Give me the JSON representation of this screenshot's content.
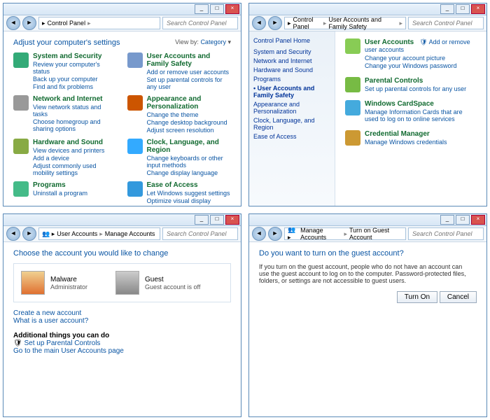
{
  "search_placeholder": "Search Control Panel",
  "p1": {
    "crumb": [
      "Control Panel"
    ],
    "heading": "Adjust your computer's settings",
    "viewby_label": "View by:",
    "viewby_value": "Category",
    "cats": [
      {
        "t": "System and Security",
        "s": [
          "Review your computer's status",
          "Back up your computer",
          "Find and fix problems"
        ]
      },
      {
        "t": "User Accounts and Family Safety",
        "s": [
          "Add or remove user accounts",
          "Set up parental controls for any user"
        ]
      },
      {
        "t": "Network and Internet",
        "s": [
          "View network status and tasks",
          "Choose homegroup and sharing options"
        ]
      },
      {
        "t": "Appearance and Personalization",
        "s": [
          "Change the theme",
          "Change desktop background",
          "Adjust screen resolution"
        ]
      },
      {
        "t": "Hardware and Sound",
        "s": [
          "View devices and printers",
          "Add a device",
          "Adjust commonly used mobility settings"
        ]
      },
      {
        "t": "Clock, Language, and Region",
        "s": [
          "Change keyboards or other input methods",
          "Change display language"
        ]
      },
      {
        "t": "Programs",
        "s": [
          "Uninstall a program"
        ]
      },
      {
        "t": "Ease of Access",
        "s": [
          "Let Windows suggest settings",
          "Optimize visual display"
        ]
      }
    ]
  },
  "p2": {
    "crumb": [
      "Control Panel",
      "User Accounts and Family Safety"
    ],
    "side_hd": "Control Panel Home",
    "side": [
      "System and Security",
      "Network and Internet",
      "Hardware and Sound",
      "Programs",
      "User Accounts and Family Safety",
      "Appearance and Personalization",
      "Clock, Language, and Region",
      "Ease of Access"
    ],
    "side_sel": 4,
    "items": [
      {
        "t": "User Accounts",
        "s": [
          "Change your account picture",
          "Change your Windows password"
        ],
        "extra": "Add or remove user accounts"
      },
      {
        "t": "Parental Controls",
        "s": [
          "Set up parental controls for any user"
        ]
      },
      {
        "t": "Windows CardSpace",
        "s": [
          "Manage Information Cards that are used to log on to online services"
        ]
      },
      {
        "t": "Credential Manager",
        "s": [
          "Manage Windows credentials"
        ]
      }
    ]
  },
  "p3": {
    "crumb": [
      "User Accounts",
      "Manage Accounts"
    ],
    "heading": "Choose the account you would like to change",
    "a1": {
      "name": "Malware",
      "role": "Administrator"
    },
    "a2": {
      "name": "Guest",
      "role": "Guest account is off"
    },
    "l1": "Create a new account",
    "l2": "What is a user account?",
    "add_hd": "Additional things you can do",
    "l3": "Set up Parental Controls",
    "l4": "Go to the main User Accounts page"
  },
  "p4": {
    "crumb": [
      "Manage Accounts",
      "Turn on Guest Account"
    ],
    "heading": "Do you want to turn on the guest account?",
    "body": "If you turn on the guest account, people who do not have an account can use the guest account to log on to the computer. Password-protected files, folders, or settings are not accessible to guest users.",
    "b1": "Turn On",
    "b2": "Cancel"
  }
}
